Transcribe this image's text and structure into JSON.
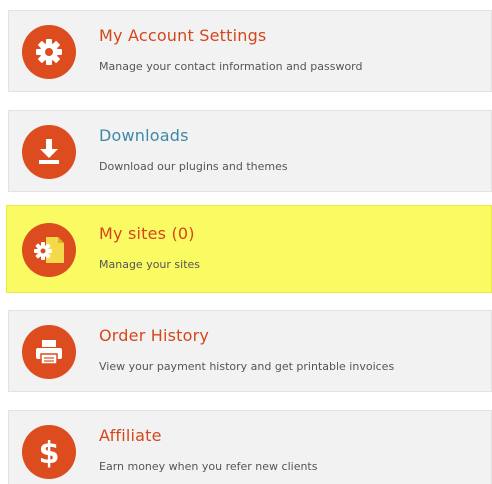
{
  "colors": {
    "accent": "#dd4c1f",
    "title_orange": "#d4471c",
    "title_blue": "#3f88a6",
    "card_bg": "#f2f2f2",
    "highlight": "#fafa63"
  },
  "menu": {
    "items": [
      {
        "title": "My Account Settings",
        "description": "Manage your contact information and password",
        "icon": "gear-icon"
      },
      {
        "title": "Downloads",
        "description": "Download our plugins and themes",
        "icon": "download-icon"
      },
      {
        "title": "My sites (0)",
        "description": "Manage your sites",
        "icon": "sites-gear-icon",
        "highlighted": true
      },
      {
        "title": "Order History",
        "description": "View your payment history and get printable invoices",
        "icon": "printer-icon"
      },
      {
        "title": "Affiliate",
        "description": "Earn money when you refer new clients",
        "icon": "dollar-icon"
      }
    ]
  }
}
